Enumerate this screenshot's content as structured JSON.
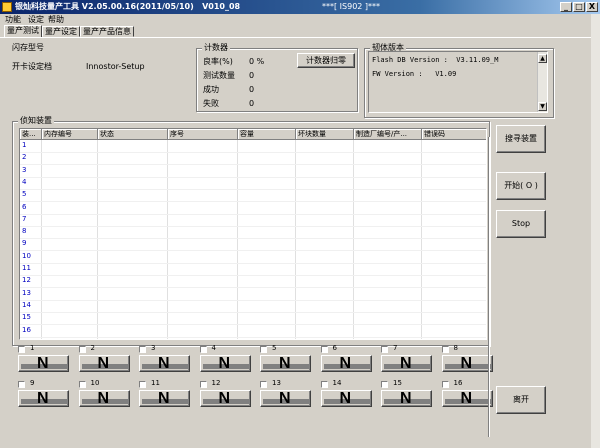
{
  "window": {
    "title": "银灿科技量产工具 V2.05.00.16(2011/05/10)   V010_08",
    "center_title": "***[ IS902 ]***",
    "minimize": "_",
    "maximize": "□",
    "close": "X"
  },
  "menu": [
    "功能",
    "设定",
    "帮助"
  ],
  "tabs": [
    "量产测试",
    "量产设定",
    "量产产品信息"
  ],
  "flash": {
    "group_label": "闪存型号",
    "setting_label": "开卡设定档",
    "setting_value": "Innostor-Setup"
  },
  "counter": {
    "group_label": "计数器",
    "rows": [
      {
        "label": "良率(%)",
        "value": "0 %"
      },
      {
        "label": "测试数量",
        "value": "0"
      },
      {
        "label": "成功",
        "value": "0"
      },
      {
        "label": "失败",
        "value": "0"
      }
    ],
    "reset_button": "计数器归零"
  },
  "firmware": {
    "group_label": "韧体版本",
    "flash_db": "Flash DB Version :  V3.11.09_M",
    "fw": "FW Version :   V1.09"
  },
  "devices": {
    "group_label": "侦知装置",
    "columns": [
      "装...",
      "内存编号",
      "状态",
      "序号",
      "容量",
      "坏块数量",
      "制造厂编号/产...",
      "错误码"
    ],
    "rows": [
      "1",
      "2",
      "3",
      "4",
      "5",
      "6",
      "7",
      "8",
      "9",
      "10",
      "11",
      "12",
      "13",
      "14",
      "15",
      "16"
    ]
  },
  "ports": [
    {
      "num": "1",
      "label": "N"
    },
    {
      "num": "2",
      "label": "N"
    },
    {
      "num": "3",
      "label": "N"
    },
    {
      "num": "4",
      "label": "N"
    },
    {
      "num": "5",
      "label": "N"
    },
    {
      "num": "6",
      "label": "N"
    },
    {
      "num": "7",
      "label": "N"
    },
    {
      "num": "8",
      "label": "N"
    },
    {
      "num": "9",
      "label": "N"
    },
    {
      "num": "10",
      "label": "N"
    },
    {
      "num": "11",
      "label": "N"
    },
    {
      "num": "12",
      "label": "N"
    },
    {
      "num": "13",
      "label": "N"
    },
    {
      "num": "14",
      "label": "N"
    },
    {
      "num": "15",
      "label": "N"
    },
    {
      "num": "16",
      "label": "N"
    }
  ],
  "actions": {
    "search": "搜寻装置",
    "start": "开始( O )",
    "stop": "Stop",
    "exit": "离开"
  }
}
